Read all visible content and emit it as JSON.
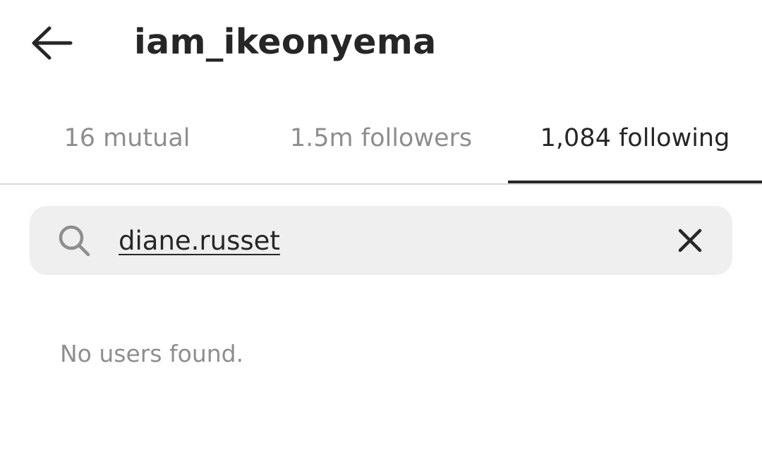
{
  "header": {
    "username": "iam_ikeonyema",
    "back_icon": "arrow-left-icon"
  },
  "tabs": [
    {
      "label": "16 mutual",
      "active": false
    },
    {
      "label": "1.5m followers",
      "active": false
    },
    {
      "label": "1,084 following",
      "active": true
    }
  ],
  "search": {
    "value": "diane.russet",
    "search_icon": "search-icon",
    "clear_icon": "close-icon"
  },
  "results": {
    "empty_message": "No users found."
  },
  "colors": {
    "text_primary": "#262626",
    "text_secondary": "#8e8e8e",
    "search_background": "#efefef",
    "divider": "#dbdbdb"
  }
}
